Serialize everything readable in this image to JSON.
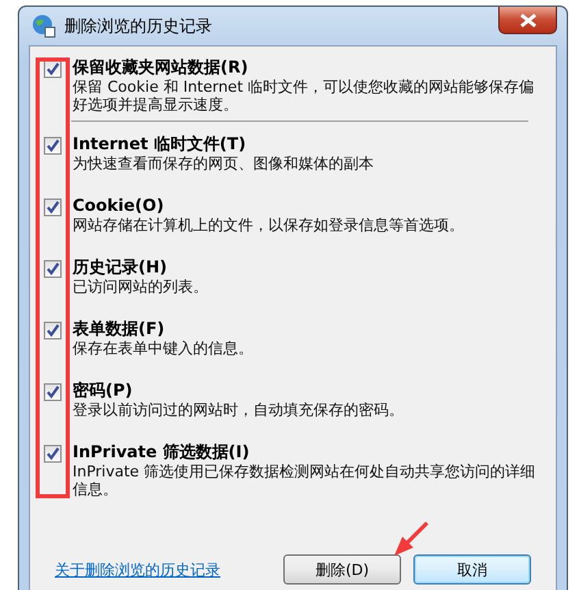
{
  "window": {
    "title": "删除浏览的历史记录"
  },
  "options": [
    {
      "label": "保留收藏夹网站数据(R)",
      "description": "保留 Cookie 和 Internet 临时文件，可以使您收藏的网站能够保存偏好选项并提高显示速度。",
      "checked": true
    },
    {
      "label": "Internet 临时文件(T)",
      "description": "为快速查看而保存的网页、图像和媒体的副本",
      "checked": true
    },
    {
      "label": "Cookie(O)",
      "description": "网站存储在计算机上的文件，以保存如登录信息等首选项。",
      "checked": true
    },
    {
      "label": "历史记录(H)",
      "description": "已访问网站的列表。",
      "checked": true
    },
    {
      "label": "表单数据(F)",
      "description": "保存在表单中键入的信息。",
      "checked": true
    },
    {
      "label": "密码(P)",
      "description": "登录以前访问过的网站时，自动填充保存的密码。",
      "checked": true
    },
    {
      "label": "InPrivate 筛选数据(I)",
      "description": "InPrivate 筛选使用已保存数据检测网站在何处自动共享您访问的详细信息。",
      "checked": true
    }
  ],
  "link": "关于删除浏览的历史记录",
  "buttons": [
    {
      "label": "删除(D)",
      "kind": "normal"
    },
    {
      "label": "取消",
      "kind": "default"
    }
  ]
}
